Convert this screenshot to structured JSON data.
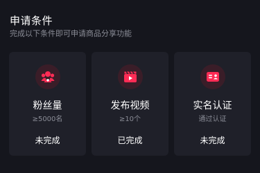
{
  "header": {
    "title": "申请条件",
    "subtitle": "完成以下条件即可申请商品分享功能"
  },
  "accent_color": "#fe2c55",
  "cards": [
    {
      "icon": "fans-icon",
      "title": "粉丝量",
      "requirement": "≥5000名",
      "status": "未完成"
    },
    {
      "icon": "video-icon",
      "title": "发布视频",
      "requirement": "≥10个",
      "status": "已完成"
    },
    {
      "icon": "id-card-icon",
      "title": "实名认证",
      "requirement": "通过认证",
      "status": "未完成"
    }
  ]
}
